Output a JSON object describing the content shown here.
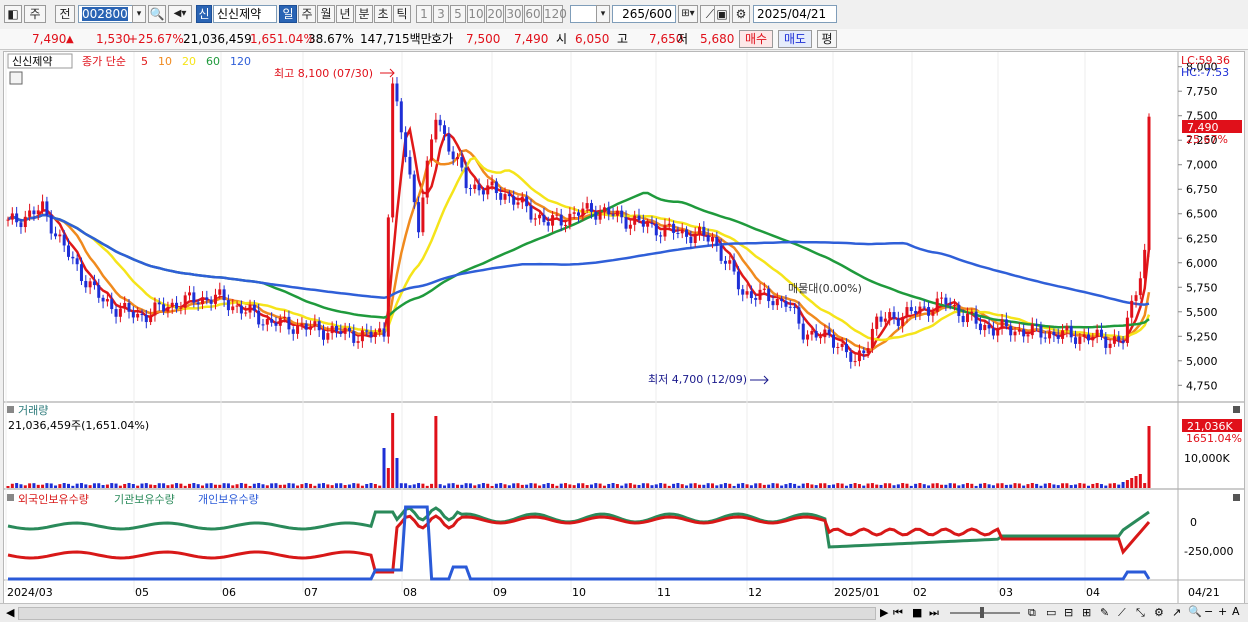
{
  "toolbar": {
    "mode_label": "주",
    "prev_label": "전",
    "code_value": "002800",
    "shin_badge": "신",
    "stock_name": "신신제약",
    "periods": [
      "일",
      "주",
      "월",
      "년",
      "분",
      "초",
      "틱"
    ],
    "intervals": [
      "1",
      "3",
      "5",
      "10",
      "20",
      "30",
      "60",
      "120"
    ],
    "count_value": "265",
    "count_total": "/600",
    "date_value": "2025/04/21"
  },
  "quote": {
    "price": "7,490",
    "arrow": "▲",
    "change": "1,530",
    "change_pct": "+25.67%",
    "volume": "21,036,459",
    "vol_ratio": "1,651.04%",
    "turnover": "38.67%",
    "amount": "147,715백만",
    "hoga_label": "호가",
    "ask": "7,500",
    "bid": "7,490",
    "open_label": "시",
    "open": "6,050",
    "high_label": "고",
    "high": "7,650",
    "low_label": "저",
    "low": "5,680",
    "buy_label": "매수",
    "sell_label": "매도",
    "eval_label": "평"
  },
  "colors": {
    "up": "#e0101a",
    "down": "#1e2fd6",
    "ma5": "#e01919",
    "ma10": "#f08a1e",
    "ma20": "#f5e41a",
    "ma60": "#1f9a3c",
    "ma120": "#2f5fd8",
    "foreign": "#d81818",
    "institution": "#2a8a5a",
    "individual": "#2a5ad8"
  },
  "price_panel": {
    "stock_tag": "신신제약",
    "legend_prefix": "종가 단순",
    "ma_labels": [
      "5",
      "10",
      "20",
      "60",
      "120"
    ],
    "lc_label": "LC:59.36",
    "hc_label": "HC:-7.53",
    "last_price_tag": "7,490",
    "last_pct_tag": "25.67%",
    "high_note": "최고 8,100 (07/30)",
    "low_note": "최저 4,700 (12/09)",
    "overlap_note": "매물대(0.00%)",
    "y_ticks": [
      "8,000",
      "7,750",
      "7,500",
      "7,250",
      "7,000",
      "6,750",
      "6,500",
      "6,250",
      "6,000",
      "5,750",
      "5,500",
      "5,250",
      "5,000",
      "4,750"
    ]
  },
  "volume_panel": {
    "title": "거래량",
    "value_label": "21,036,459주(1,651.04%)",
    "tag_value": "21,036K",
    "tag_pct": "1651.04%",
    "y_tick": "10,000K"
  },
  "holder_panel": {
    "legend": [
      "외국인보유수량",
      "기관보유수량",
      "개인보유수량"
    ],
    "y_ticks": [
      "0",
      "-250,000"
    ]
  },
  "x_axis": {
    "labels": [
      "2024/03",
      "05",
      "06",
      "07",
      "08",
      "09",
      "10",
      "11",
      "12",
      "2025/01",
      "02",
      "03",
      "04"
    ],
    "right_label": "04/21"
  },
  "chart_data": {
    "type": "candlestick",
    "y_range": [
      4600,
      8150
    ],
    "ma_labels": [
      "5",
      "10",
      "20",
      "60",
      "120"
    ],
    "high": {
      "value": 8100,
      "date": "07/30"
    },
    "low": {
      "value": 4700,
      "date": "12/09"
    },
    "last_close": 7490
  }
}
